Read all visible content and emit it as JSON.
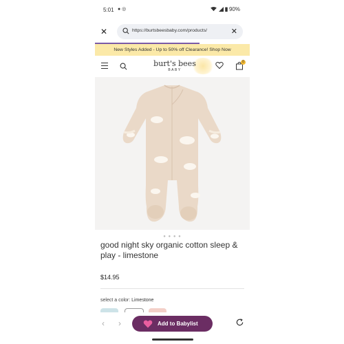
{
  "status_bar": {
    "time": "5:01",
    "notification_icons": "● ◎",
    "battery": "90%"
  },
  "browser": {
    "url": "https://burtsbeesbaby.com/products/",
    "accent_color": "#7a5aa6"
  },
  "promo_banner": {
    "text": "New Styles Added - Up to 50% off Clearance! Shop Now",
    "bg_color": "#fbe9a8"
  },
  "header": {
    "logo_main": "burt's bees",
    "logo_sub": "BABY",
    "cart_count": "0"
  },
  "product": {
    "title": "good night sky organic cotton sleep & play - limestone",
    "price": "$14.95",
    "image_dots": "● ● ● ●",
    "color_label": "select a color:",
    "color_value": "Limestone"
  },
  "swatches": [
    {
      "name": "swatch-1",
      "color": "#cde3e8"
    },
    {
      "name": "swatch-2",
      "color": "#ffffff"
    },
    {
      "name": "swatch-3",
      "color": "#f3cfc8"
    }
  ],
  "bottom_bar": {
    "add_button_label": "Add to Babylist",
    "button_color": "#6b2d63"
  }
}
